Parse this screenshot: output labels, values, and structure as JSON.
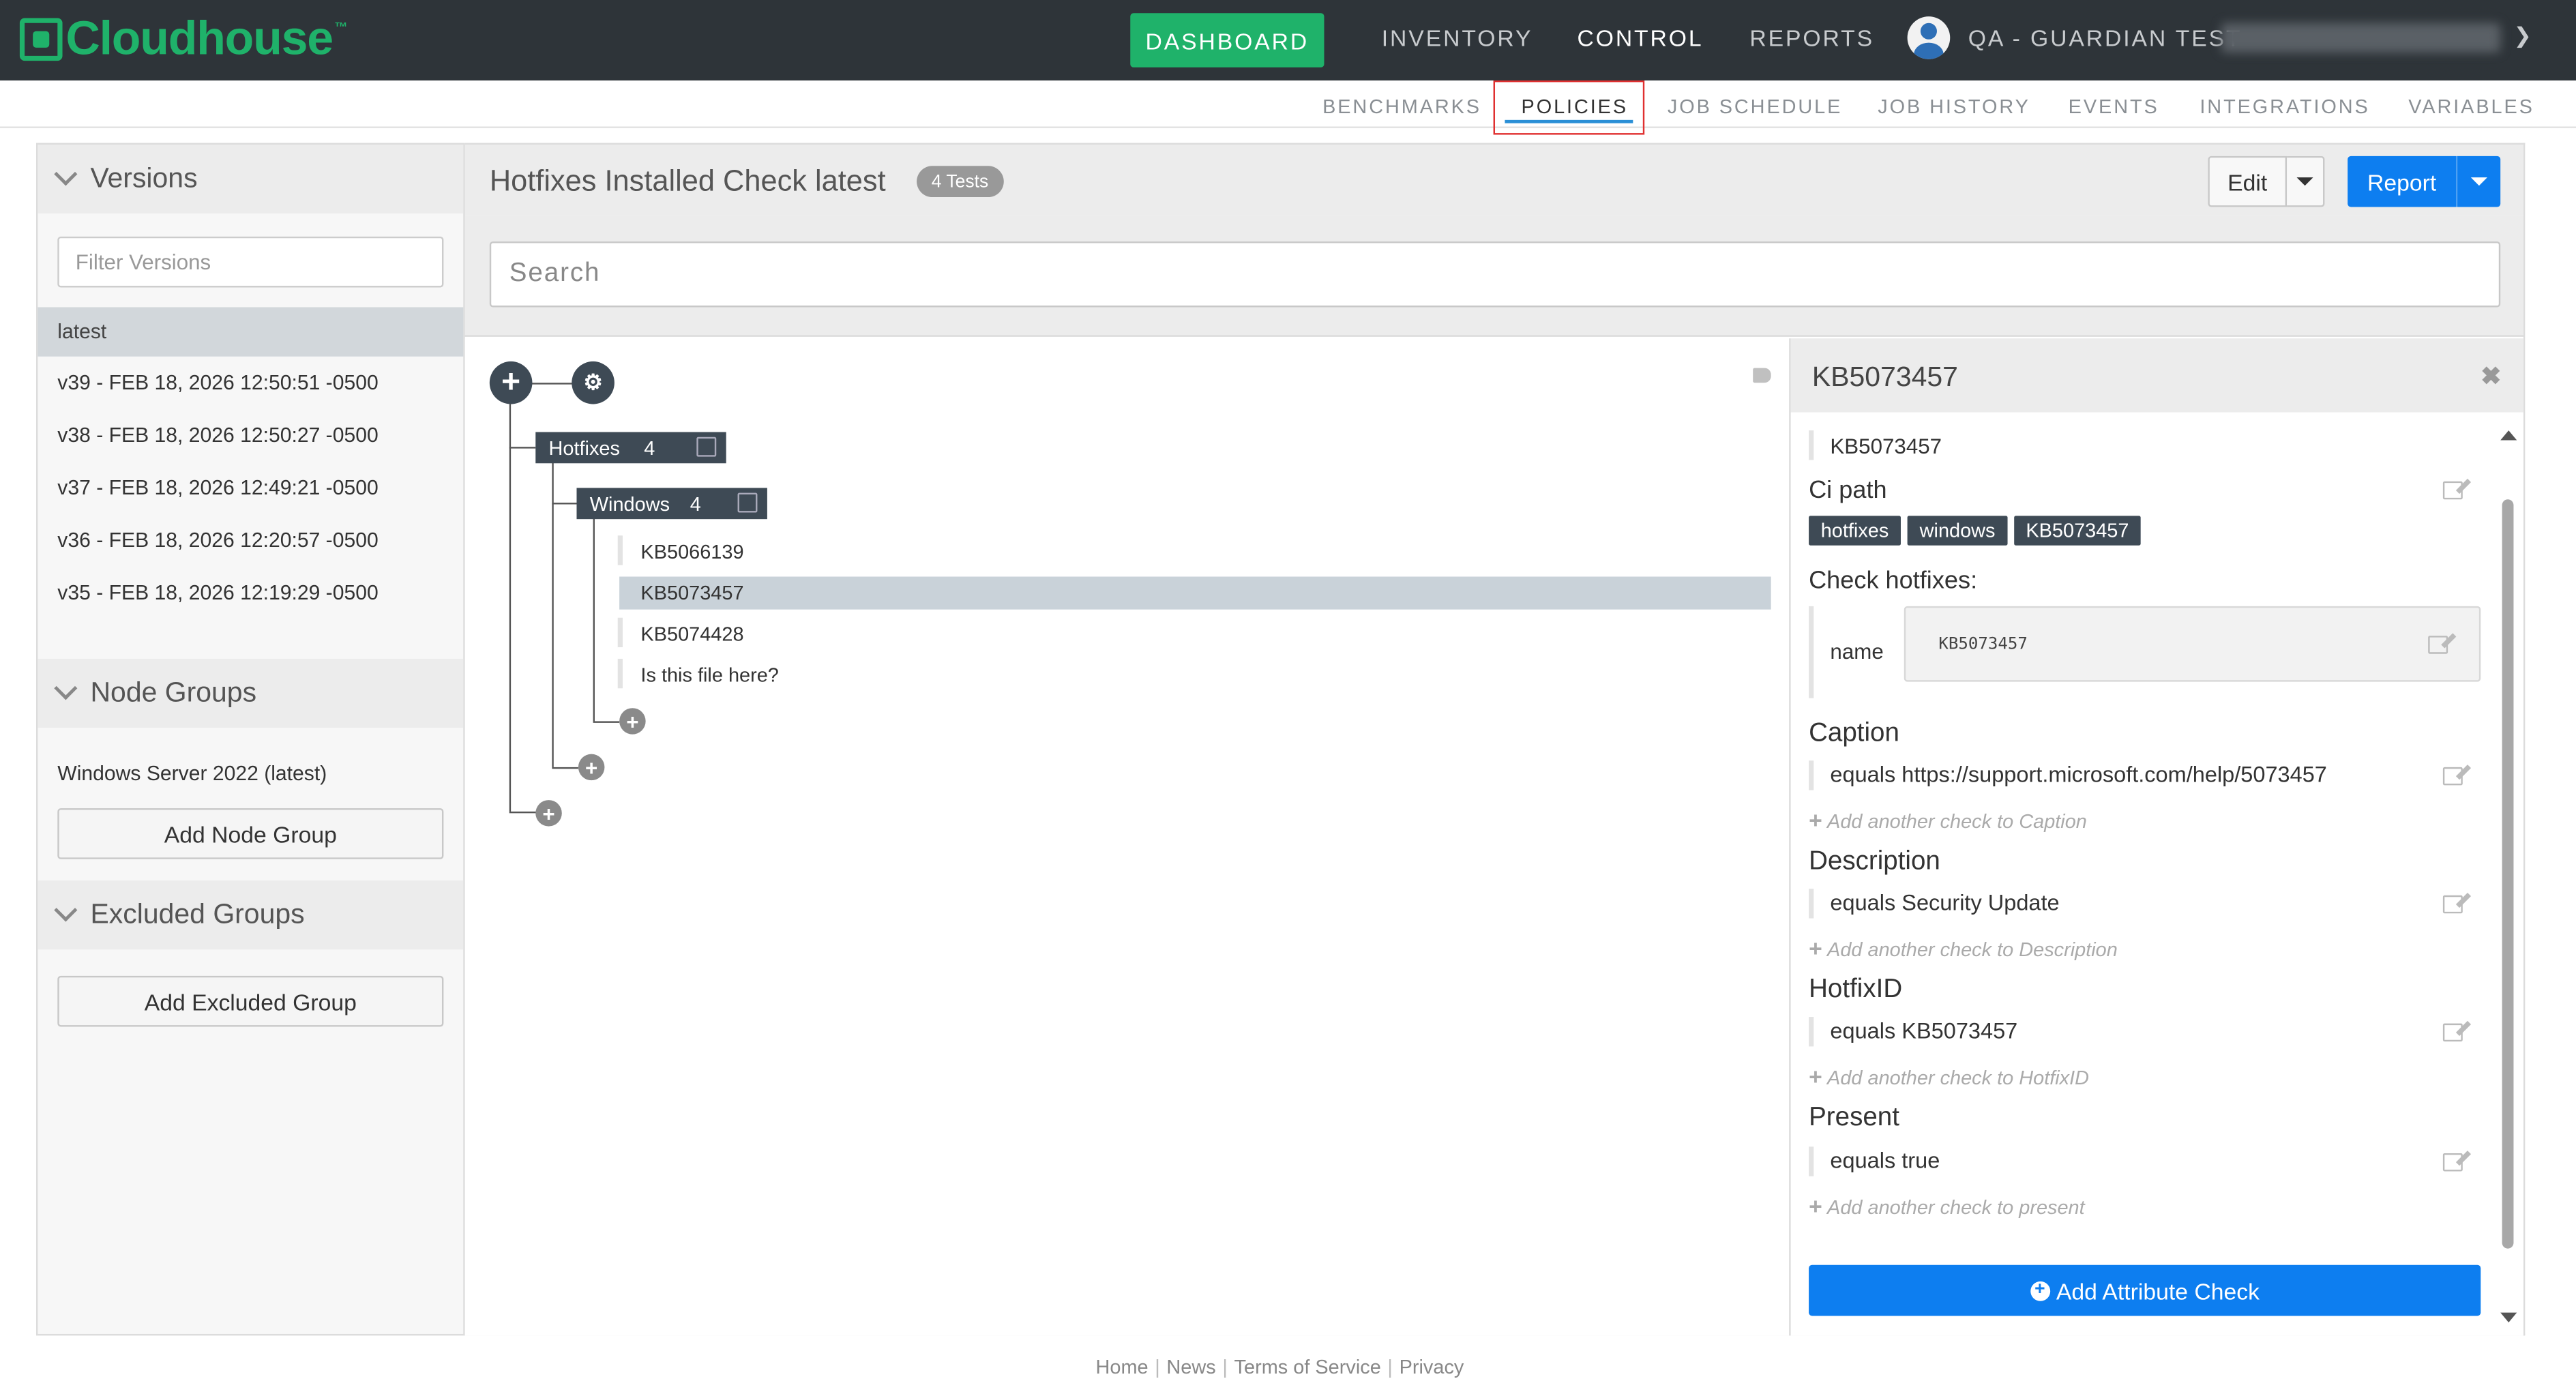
{
  "brand": {
    "name": "Cloudhouse",
    "tm": "™"
  },
  "nav": {
    "dashboard": "DASHBOARD",
    "inventory": "INVENTORY",
    "control": "CONTROL",
    "reports": "REPORTS",
    "user": "QA - GUARDIAN TEST"
  },
  "subnav": [
    "BENCHMARKS",
    "POLICIES",
    "JOB SCHEDULE",
    "JOB HISTORY",
    "EVENTS",
    "INTEGRATIONS",
    "VARIABLES"
  ],
  "sidebar": {
    "versions_title": "Versions",
    "filter_placeholder": "Filter Versions",
    "versions": [
      "latest",
      "v39 - FEB 18, 2026 12:50:51 -0500",
      "v38 - FEB 18, 2026 12:50:27 -0500",
      "v37 - FEB 18, 2026 12:49:21 -0500",
      "v36 - FEB 18, 2026 12:20:57 -0500",
      "v35 - FEB 18, 2026 12:19:29 -0500"
    ],
    "node_groups_title": "Node Groups",
    "node_group": "Windows Server 2022 (latest)",
    "add_node_group": "Add Node Group",
    "excluded_groups_title": "Excluded Groups",
    "add_excluded_group": "Add Excluded Group"
  },
  "main": {
    "title": "Hotfixes Installed Check latest",
    "tests_badge": "4 Tests",
    "edit": "Edit",
    "report": "Report",
    "search_placeholder": "Search"
  },
  "tree": {
    "root": {
      "label": "Hotfixes",
      "count": "4"
    },
    "child": {
      "label": "Windows",
      "count": "4"
    },
    "leaves": [
      "KB5066139",
      "KB5073457",
      "KB5074428",
      "Is this file here?"
    ],
    "selected_index": 1
  },
  "detail": {
    "title": "KB5073457",
    "name_line": "KB5073457",
    "ci_path_label": "Ci path",
    "ci_path": [
      "hotfixes",
      "windows",
      "KB5073457"
    ],
    "check_hotfixes_label": "Check hotfixes:",
    "name_label": "name",
    "name_value": "KB5073457",
    "sections": [
      {
        "title": "Caption",
        "check": "equals https://support.microsoft.com/help/5073457",
        "add": "Add another check to Caption"
      },
      {
        "title": "Description",
        "check": "equals Security Update",
        "add": "Add another check to Description"
      },
      {
        "title": "HotfixID",
        "check": "equals KB5073457",
        "add": "Add another check to HotfixID"
      },
      {
        "title": "Present",
        "check": "equals true",
        "add": "Add another check to present"
      }
    ],
    "add_attribute": "Add Attribute Check"
  },
  "footer": [
    "Home",
    "News",
    "Terms of Service",
    "Privacy"
  ]
}
